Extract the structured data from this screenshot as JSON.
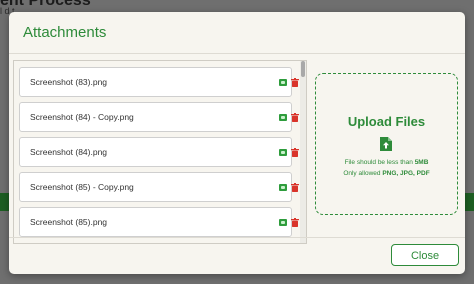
{
  "background": {
    "title": "ent Process",
    "subtitle": "l d    t"
  },
  "modal": {
    "title": "Attachments",
    "files": [
      {
        "name": "Screenshot (83).png"
      },
      {
        "name": "Screenshot (84) - Copy.png"
      },
      {
        "name": "Screenshot (84).png"
      },
      {
        "name": "Screenshot (85) - Copy.png"
      },
      {
        "name": "Screenshot (85).png"
      }
    ],
    "upload": {
      "title": "Upload Files",
      "size_note_prefix": "File should be less than ",
      "size_limit": "5MB",
      "types_note_prefix": "Only allowed ",
      "types": "PNG, JPG, PDF"
    },
    "close_label": "Close"
  },
  "colors": {
    "accent": "#2e8b3a",
    "delete": "#d9342b",
    "view": "#2e9c3c"
  },
  "icons": {
    "view": "view-icon",
    "delete": "trash-icon",
    "upload": "file-upload-icon"
  }
}
